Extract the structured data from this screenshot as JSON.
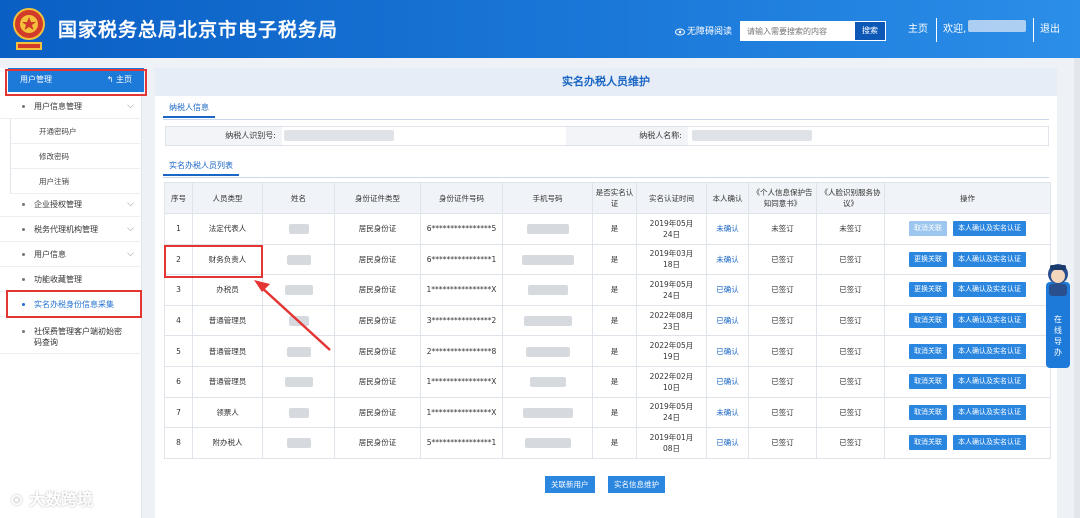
{
  "header": {
    "title": "国家税务总局北京市电子税务局",
    "accessibility": "无障碍阅读",
    "search_placeholder": "请输入需要搜索的内容",
    "search_button": "搜索",
    "home": "主页",
    "welcome": "欢迎,",
    "logout": "退出",
    "bg_color": "#1a77d8"
  },
  "sidebar": {
    "head_label": "用户管理",
    "head_home": "主页",
    "items": [
      {
        "label": "用户信息管理",
        "expanded": true
      },
      {
        "label": "开通密码户"
      },
      {
        "label": "修改密码"
      },
      {
        "label": "用户注销"
      },
      {
        "label": "企业授权管理"
      },
      {
        "label": "税务代理机构管理"
      },
      {
        "label": "用户信息"
      },
      {
        "label": "功能收藏管理"
      },
      {
        "label": "实名办税身份信息采集",
        "active": true
      },
      {
        "label": "社保费管理客户端初始密码查询"
      }
    ]
  },
  "main": {
    "title": "实名办税人员维护",
    "tab_taxpayer": "纳税人信息",
    "taxpayer_id_label": "纳税人识别号:",
    "taxpayer_name_label": "纳税人名称:",
    "tab_list": "实名办税人员列表",
    "columns": [
      "序号",
      "人员类型",
      "姓名",
      "身份证件类型",
      "身份证件号码",
      "手机号码",
      "是否实名认证",
      "实名认证时间",
      "本人确认",
      "《个人信息保护告知同意书》",
      "《人脸识别服务协议》",
      "操作"
    ],
    "rows": [
      {
        "no": "1",
        "type": "法定代表人",
        "id_type": "居民身份证",
        "id_no": "6****************5",
        "verified": "是",
        "time": "2019年05月24日",
        "confirm": "未确认",
        "consent": "未签订",
        "face": "未签订",
        "op1": "取消关联",
        "op1_disabled": true,
        "op2": "本人确认及实名认证"
      },
      {
        "no": "2",
        "type": "财务负责人",
        "id_type": "居民身份证",
        "id_no": "6****************1",
        "verified": "是",
        "time": "2019年03月18日",
        "confirm": "未确认",
        "consent": "已签订",
        "face": "已签订",
        "op1": "更换关联",
        "op1_disabled": false,
        "op2": "本人确认及实名认证"
      },
      {
        "no": "3",
        "type": "办税员",
        "id_type": "居民身份证",
        "id_no": "1****************X",
        "verified": "是",
        "time": "2019年05月24日",
        "confirm": "已确认",
        "consent": "已签订",
        "face": "已签订",
        "op1": "更换关联",
        "op1_disabled": false,
        "op2": "本人确认及实名认证"
      },
      {
        "no": "4",
        "type": "普通管理员",
        "id_type": "居民身份证",
        "id_no": "3****************2",
        "verified": "是",
        "time": "2022年08月23日",
        "confirm": "已确认",
        "consent": "已签订",
        "face": "已签订",
        "op1": "取消关联",
        "op1_disabled": false,
        "op2": "本人确认及实名认证"
      },
      {
        "no": "5",
        "type": "普通管理员",
        "id_type": "居民身份证",
        "id_no": "2****************8",
        "verified": "是",
        "time": "2022年05月19日",
        "confirm": "已确认",
        "consent": "已签订",
        "face": "已签订",
        "op1": "取消关联",
        "op1_disabled": false,
        "op2": "本人确认及实名认证"
      },
      {
        "no": "6",
        "type": "普通管理员",
        "id_type": "居民身份证",
        "id_no": "1****************X",
        "verified": "是",
        "time": "2022年02月10日",
        "confirm": "已确认",
        "consent": "已签订",
        "face": "已签订",
        "op1": "取消关联",
        "op1_disabled": false,
        "op2": "本人确认及实名认证"
      },
      {
        "no": "7",
        "type": "领票人",
        "id_type": "居民身份证",
        "id_no": "1****************X",
        "verified": "是",
        "time": "2019年05月24日",
        "confirm": "未确认",
        "consent": "已签订",
        "face": "已签订",
        "op1": "取消关联",
        "op1_disabled": false,
        "op2": "本人确认及实名认证"
      },
      {
        "no": "8",
        "type": "附办税人",
        "id_type": "居民身份证",
        "id_no": "5****************1",
        "verified": "是",
        "time": "2019年01月08日",
        "confirm": "已确认",
        "consent": "已签订",
        "face": "已签订",
        "op1": "取消关联",
        "op1_disabled": false,
        "op2": "本人确认及实名认证"
      }
    ],
    "bottom_btn_1": "关联新用户",
    "bottom_btn_2": "实名信息维护"
  },
  "float_widget": "在线导办",
  "watermark": "大数跨境",
  "colors": {
    "accent": "#1a66c4",
    "highlight": "#e43535",
    "button": "#2b86e0"
  }
}
